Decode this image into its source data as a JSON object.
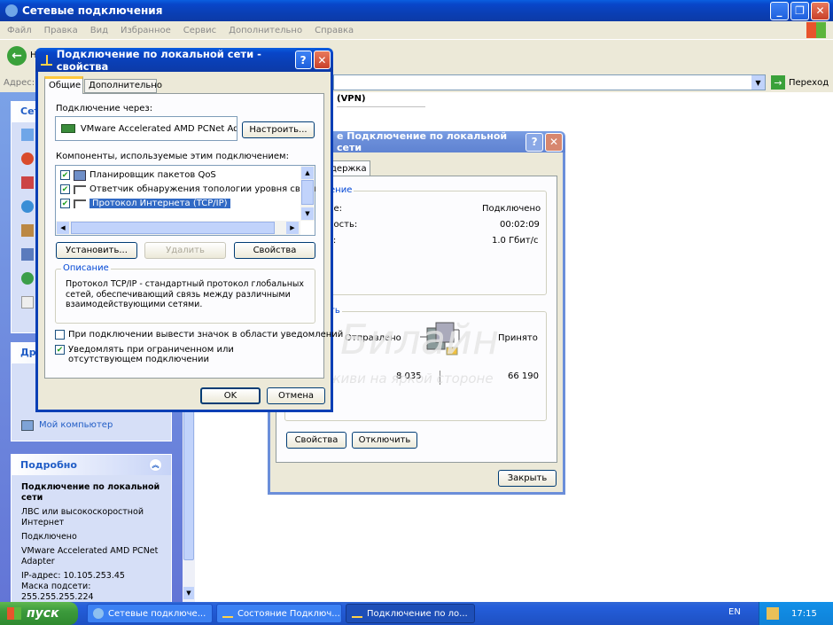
{
  "explorer": {
    "title": "Сетевые подключения",
    "menu": [
      "Файл",
      "Правка",
      "Вид",
      "Избранное",
      "Сервис",
      "Дополнительно",
      "Справка"
    ],
    "back_partial": "Н",
    "address_label": "Адрес:",
    "go_label": "Переход",
    "vpn_text": "(VPN)"
  },
  "sidebar": {
    "network_tasks_partial": "Сете",
    "other_places_partial": "Дру",
    "my_computer": "Мой компьютер",
    "details": {
      "header": "Подробно",
      "name": "Подключение по локальной сети",
      "type": "ЛВС или высокоскоростной Интернет",
      "status": "Подключено",
      "adapter": "VMware Accelerated AMD PCNet Adapter",
      "ip": "IP-адрес: 10.105.253.45",
      "mask": "Маска подсети: 255.255.255.224"
    }
  },
  "status_dialog": {
    "title_partial": "е Подключение по локальной сети",
    "tab_partial": "держка",
    "group1_partial": "ение",
    "rows": [
      {
        "label": "ие:",
        "value": "Подключено"
      },
      {
        "label": "ность:",
        "value": "00:02:09"
      },
      {
        "label": "ь:",
        "value": "1.0 Гбит/с"
      }
    ],
    "group2_partial": "ть",
    "sent_label": "Отправлено",
    "recv_label": "Принято",
    "sent_value": "8 035",
    "recv_value": "66 190",
    "props_btn": "Свойства",
    "disable_btn": "Отключить",
    "close_btn": "Закрыть"
  },
  "props_dialog": {
    "title": "Подключение по локальной сети - свойства",
    "tabs": [
      "Общие",
      "Дополнительно"
    ],
    "connect_via": "Подключение через:",
    "adapter": "VMware Accelerated AMD PCNet Ad",
    "configure_btn": "Настроить...",
    "components_label": "Компоненты, используемые этим подключением:",
    "components": [
      {
        "label": "Планировщик пакетов QoS",
        "checked": true,
        "selected": false
      },
      {
        "label": "Ответчик обнаружения топологии уровня связи",
        "checked": true,
        "selected": false
      },
      {
        "label": "Протокол Интернета (TCP/IP)",
        "checked": true,
        "selected": true
      }
    ],
    "install_btn": "Установить...",
    "remove_btn": "Удалить",
    "properties_btn": "Свойства",
    "desc_label": "Описание",
    "description": "Протокол TCP/IP - стандартный протокол глобальных сетей, обеспечивающий связь между различными взаимодействующими сетями.",
    "notify_icon": "При подключении вывести значок в области уведомлений",
    "notify_limited": "Уведомлять при ограниченном или отсутствующем подключении",
    "ok": "OK",
    "cancel": "Отмена"
  },
  "watermark": {
    "brand": "Билайн",
    "slogan": "живи на яркой стороне"
  },
  "taskbar": {
    "start": "пуск",
    "items": [
      "Сетевые подключе...",
      "Состояние Подключ...",
      "Подключение по ло..."
    ],
    "lang": "EN",
    "clock": "17:15"
  },
  "colors": {
    "xp_blue": "#0a3fb5",
    "taskbar": "#245edb",
    "start_green": "#3c9a3c"
  }
}
